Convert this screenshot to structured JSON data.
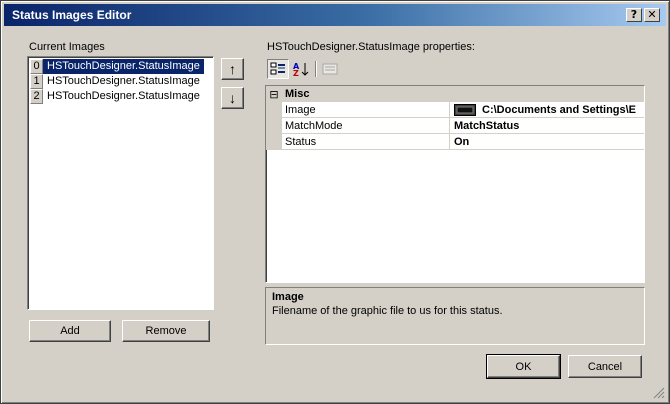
{
  "window": {
    "title": "Status Images Editor",
    "help_button": "?",
    "close_button": "✕"
  },
  "left_panel": {
    "label": "Current Images",
    "items": [
      {
        "index": "0",
        "text": "HSTouchDesigner.StatusImage",
        "selected": true
      },
      {
        "index": "1",
        "text": "HSTouchDesigner.StatusImage",
        "selected": false
      },
      {
        "index": "2",
        "text": "HSTouchDesigner.StatusImage",
        "selected": false
      }
    ],
    "move_up": "↑",
    "move_down": "↓",
    "add_label": "Add",
    "remove_label": "Remove"
  },
  "properties": {
    "label": "HSTouchDesigner.StatusImage properties:",
    "category": {
      "toggle": "⊟",
      "name": "Misc"
    },
    "rows": [
      {
        "name": "Image",
        "value": "C:\\Documents and Settings\\E"
      },
      {
        "name": "MatchMode",
        "value": "MatchStatus"
      },
      {
        "name": "Status",
        "value": "On"
      }
    ],
    "help_title": "Image",
    "help_text": "Filename of the graphic file to us for this status."
  },
  "footer": {
    "ok_label": "OK",
    "cancel_label": "Cancel"
  },
  "colors": {
    "selection": "#0a246a",
    "face": "#d4d0c8"
  }
}
